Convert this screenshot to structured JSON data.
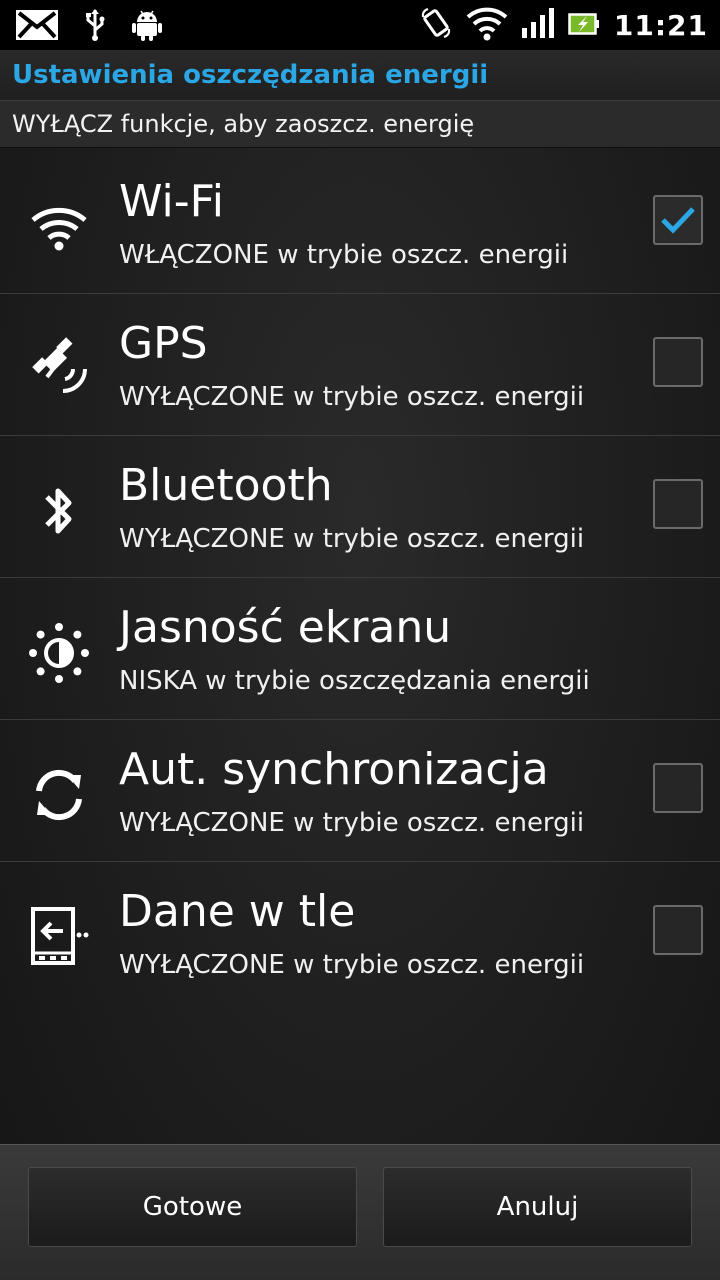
{
  "status_bar": {
    "time": "11:21",
    "left_icons": [
      "mail-icon",
      "usb-icon",
      "android-debug-icon"
    ],
    "right_icons": [
      "rotate-icon",
      "wifi-signal-icon",
      "cell-signal-icon",
      "battery-charging-icon"
    ]
  },
  "header": {
    "title": "Ustawienia oszczędzania energii",
    "subtitle": "WYŁĄCZ funkcje, aby zaoszcz. energię"
  },
  "items": [
    {
      "icon": "wifi-icon",
      "title": "Wi-Fi",
      "subtitle": "WŁĄCZONE w trybie oszcz. energii",
      "checked": true
    },
    {
      "icon": "gps-icon",
      "title": "GPS",
      "subtitle": "WYŁĄCZONE w trybie oszcz. energii",
      "checked": false
    },
    {
      "icon": "bluetooth-icon",
      "title": "Bluetooth",
      "subtitle": "WYŁĄCZONE w trybie oszcz. energii",
      "checked": false
    },
    {
      "icon": "brightness-icon",
      "title": "Jasność ekranu",
      "subtitle": "NISKA w trybie oszczędzania energii"
    },
    {
      "icon": "sync-icon",
      "title": "Aut. synchronizacja",
      "subtitle": "WYŁĄCZONE w trybie oszcz. energii",
      "checked": false
    },
    {
      "icon": "background-data-icon",
      "title": "Dane w tle",
      "subtitle": "WYŁĄCZONE w trybie oszcz. energii",
      "checked": false
    }
  ],
  "buttons": {
    "done": "Gotowe",
    "cancel": "Anuluj"
  },
  "colors": {
    "accent": "#2aa7e4",
    "check": "#2aa7e4"
  }
}
